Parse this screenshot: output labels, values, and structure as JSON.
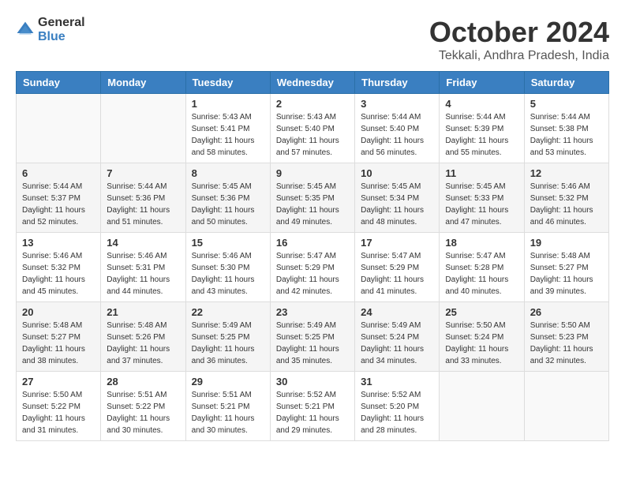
{
  "header": {
    "logo_general": "General",
    "logo_blue": "Blue",
    "month_title": "October 2024",
    "location": "Tekkali, Andhra Pradesh, India"
  },
  "days_of_week": [
    "Sunday",
    "Monday",
    "Tuesday",
    "Wednesday",
    "Thursday",
    "Friday",
    "Saturday"
  ],
  "weeks": [
    [
      {
        "day": "",
        "sunrise": "",
        "sunset": "",
        "daylight": ""
      },
      {
        "day": "",
        "sunrise": "",
        "sunset": "",
        "daylight": ""
      },
      {
        "day": "1",
        "sunrise": "Sunrise: 5:43 AM",
        "sunset": "Sunset: 5:41 PM",
        "daylight": "Daylight: 11 hours and 58 minutes."
      },
      {
        "day": "2",
        "sunrise": "Sunrise: 5:43 AM",
        "sunset": "Sunset: 5:40 PM",
        "daylight": "Daylight: 11 hours and 57 minutes."
      },
      {
        "day": "3",
        "sunrise": "Sunrise: 5:44 AM",
        "sunset": "Sunset: 5:40 PM",
        "daylight": "Daylight: 11 hours and 56 minutes."
      },
      {
        "day": "4",
        "sunrise": "Sunrise: 5:44 AM",
        "sunset": "Sunset: 5:39 PM",
        "daylight": "Daylight: 11 hours and 55 minutes."
      },
      {
        "day": "5",
        "sunrise": "Sunrise: 5:44 AM",
        "sunset": "Sunset: 5:38 PM",
        "daylight": "Daylight: 11 hours and 53 minutes."
      }
    ],
    [
      {
        "day": "6",
        "sunrise": "Sunrise: 5:44 AM",
        "sunset": "Sunset: 5:37 PM",
        "daylight": "Daylight: 11 hours and 52 minutes."
      },
      {
        "day": "7",
        "sunrise": "Sunrise: 5:44 AM",
        "sunset": "Sunset: 5:36 PM",
        "daylight": "Daylight: 11 hours and 51 minutes."
      },
      {
        "day": "8",
        "sunrise": "Sunrise: 5:45 AM",
        "sunset": "Sunset: 5:36 PM",
        "daylight": "Daylight: 11 hours and 50 minutes."
      },
      {
        "day": "9",
        "sunrise": "Sunrise: 5:45 AM",
        "sunset": "Sunset: 5:35 PM",
        "daylight": "Daylight: 11 hours and 49 minutes."
      },
      {
        "day": "10",
        "sunrise": "Sunrise: 5:45 AM",
        "sunset": "Sunset: 5:34 PM",
        "daylight": "Daylight: 11 hours and 48 minutes."
      },
      {
        "day": "11",
        "sunrise": "Sunrise: 5:45 AM",
        "sunset": "Sunset: 5:33 PM",
        "daylight": "Daylight: 11 hours and 47 minutes."
      },
      {
        "day": "12",
        "sunrise": "Sunrise: 5:46 AM",
        "sunset": "Sunset: 5:32 PM",
        "daylight": "Daylight: 11 hours and 46 minutes."
      }
    ],
    [
      {
        "day": "13",
        "sunrise": "Sunrise: 5:46 AM",
        "sunset": "Sunset: 5:32 PM",
        "daylight": "Daylight: 11 hours and 45 minutes."
      },
      {
        "day": "14",
        "sunrise": "Sunrise: 5:46 AM",
        "sunset": "Sunset: 5:31 PM",
        "daylight": "Daylight: 11 hours and 44 minutes."
      },
      {
        "day": "15",
        "sunrise": "Sunrise: 5:46 AM",
        "sunset": "Sunset: 5:30 PM",
        "daylight": "Daylight: 11 hours and 43 minutes."
      },
      {
        "day": "16",
        "sunrise": "Sunrise: 5:47 AM",
        "sunset": "Sunset: 5:29 PM",
        "daylight": "Daylight: 11 hours and 42 minutes."
      },
      {
        "day": "17",
        "sunrise": "Sunrise: 5:47 AM",
        "sunset": "Sunset: 5:29 PM",
        "daylight": "Daylight: 11 hours and 41 minutes."
      },
      {
        "day": "18",
        "sunrise": "Sunrise: 5:47 AM",
        "sunset": "Sunset: 5:28 PM",
        "daylight": "Daylight: 11 hours and 40 minutes."
      },
      {
        "day": "19",
        "sunrise": "Sunrise: 5:48 AM",
        "sunset": "Sunset: 5:27 PM",
        "daylight": "Daylight: 11 hours and 39 minutes."
      }
    ],
    [
      {
        "day": "20",
        "sunrise": "Sunrise: 5:48 AM",
        "sunset": "Sunset: 5:27 PM",
        "daylight": "Daylight: 11 hours and 38 minutes."
      },
      {
        "day": "21",
        "sunrise": "Sunrise: 5:48 AM",
        "sunset": "Sunset: 5:26 PM",
        "daylight": "Daylight: 11 hours and 37 minutes."
      },
      {
        "day": "22",
        "sunrise": "Sunrise: 5:49 AM",
        "sunset": "Sunset: 5:25 PM",
        "daylight": "Daylight: 11 hours and 36 minutes."
      },
      {
        "day": "23",
        "sunrise": "Sunrise: 5:49 AM",
        "sunset": "Sunset: 5:25 PM",
        "daylight": "Daylight: 11 hours and 35 minutes."
      },
      {
        "day": "24",
        "sunrise": "Sunrise: 5:49 AM",
        "sunset": "Sunset: 5:24 PM",
        "daylight": "Daylight: 11 hours and 34 minutes."
      },
      {
        "day": "25",
        "sunrise": "Sunrise: 5:50 AM",
        "sunset": "Sunset: 5:24 PM",
        "daylight": "Daylight: 11 hours and 33 minutes."
      },
      {
        "day": "26",
        "sunrise": "Sunrise: 5:50 AM",
        "sunset": "Sunset: 5:23 PM",
        "daylight": "Daylight: 11 hours and 32 minutes."
      }
    ],
    [
      {
        "day": "27",
        "sunrise": "Sunrise: 5:50 AM",
        "sunset": "Sunset: 5:22 PM",
        "daylight": "Daylight: 11 hours and 31 minutes."
      },
      {
        "day": "28",
        "sunrise": "Sunrise: 5:51 AM",
        "sunset": "Sunset: 5:22 PM",
        "daylight": "Daylight: 11 hours and 30 minutes."
      },
      {
        "day": "29",
        "sunrise": "Sunrise: 5:51 AM",
        "sunset": "Sunset: 5:21 PM",
        "daylight": "Daylight: 11 hours and 30 minutes."
      },
      {
        "day": "30",
        "sunrise": "Sunrise: 5:52 AM",
        "sunset": "Sunset: 5:21 PM",
        "daylight": "Daylight: 11 hours and 29 minutes."
      },
      {
        "day": "31",
        "sunrise": "Sunrise: 5:52 AM",
        "sunset": "Sunset: 5:20 PM",
        "daylight": "Daylight: 11 hours and 28 minutes."
      },
      {
        "day": "",
        "sunrise": "",
        "sunset": "",
        "daylight": ""
      },
      {
        "day": "",
        "sunrise": "",
        "sunset": "",
        "daylight": ""
      }
    ]
  ]
}
